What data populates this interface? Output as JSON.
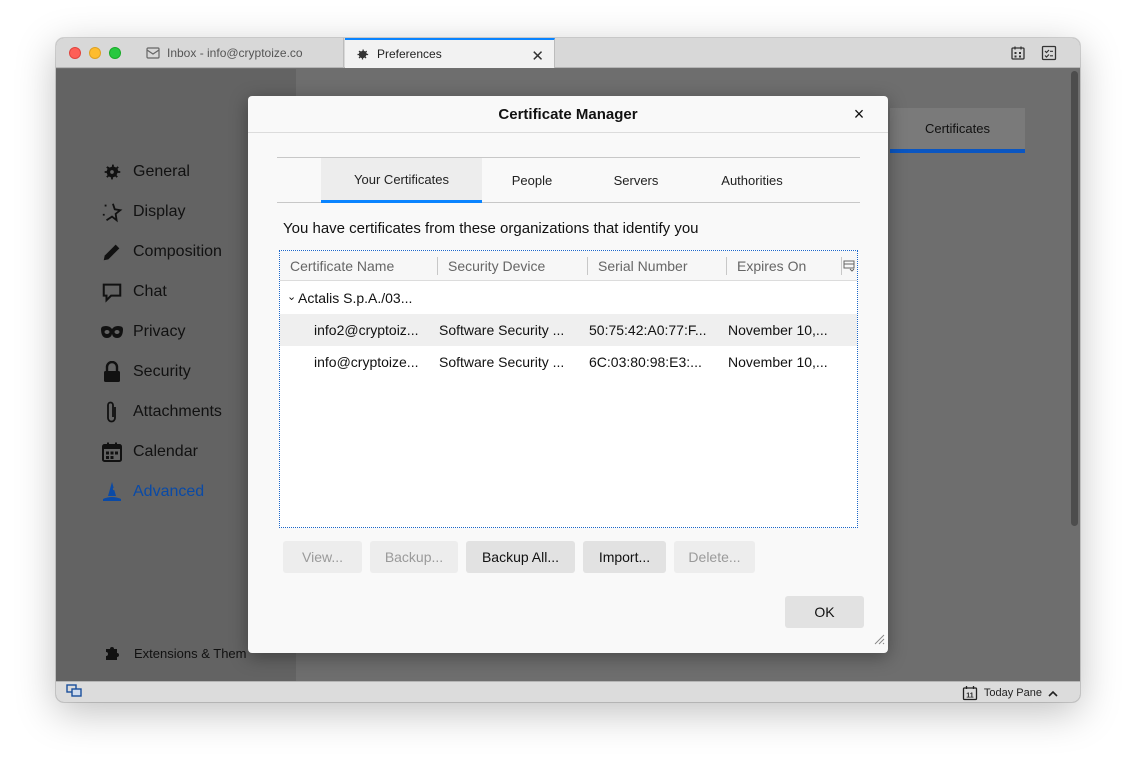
{
  "window": {
    "tabs": [
      {
        "label": "Inbox - info@cryptoize.co",
        "icon": "mail-icon"
      },
      {
        "label": "Preferences",
        "icon": "gear-icon"
      }
    ]
  },
  "sidebar": {
    "items": [
      {
        "label": "General",
        "icon": "gear-icon"
      },
      {
        "label": "Display",
        "icon": "display-icon"
      },
      {
        "label": "Composition",
        "icon": "pencil-icon"
      },
      {
        "label": "Chat",
        "icon": "chat-icon"
      },
      {
        "label": "Privacy",
        "icon": "mask-icon"
      },
      {
        "label": "Security",
        "icon": "lock-icon"
      },
      {
        "label": "Attachments",
        "icon": "paperclip-icon"
      },
      {
        "label": "Calendar",
        "icon": "calendar-icon"
      },
      {
        "label": "Advanced",
        "icon": "wizard-icon",
        "active": true
      }
    ],
    "extensions_label": "Extensions & Them"
  },
  "preferences": {
    "certificates_tab": "Certificates"
  },
  "statusbar": {
    "today_pane": "Today Pane",
    "today_icon_day": "11"
  },
  "dialog": {
    "title": "Certificate Manager",
    "close": "×",
    "tabs": [
      "Your Certificates",
      "People",
      "Servers",
      "Authorities"
    ],
    "active_tab": "Your Certificates",
    "intro": "You have certificates from these organizations that identify you",
    "columns": [
      "Certificate Name",
      "Security Device",
      "Serial Number",
      "Expires On"
    ],
    "group": {
      "chevron": "⌄",
      "label": "Actalis S.p.A./03..."
    },
    "rows": [
      {
        "name": "info2@cryptoiz...",
        "device": "Software Security ...",
        "serial": "50:75:42:A0:77:F...",
        "expires": "November 10,..."
      },
      {
        "name": "info@cryptoize...",
        "device": "Software Security ...",
        "serial": "6C:03:80:98:E3:...",
        "expires": "November 10,..."
      }
    ],
    "buttons": {
      "view": "View...",
      "backup": "Backup...",
      "backup_all": "Backup All...",
      "import": "Import...",
      "delete": "Delete..."
    },
    "ok": "OK"
  },
  "colors": {
    "accent": "#0a84ff",
    "active_nav": "#0a4aa6"
  }
}
